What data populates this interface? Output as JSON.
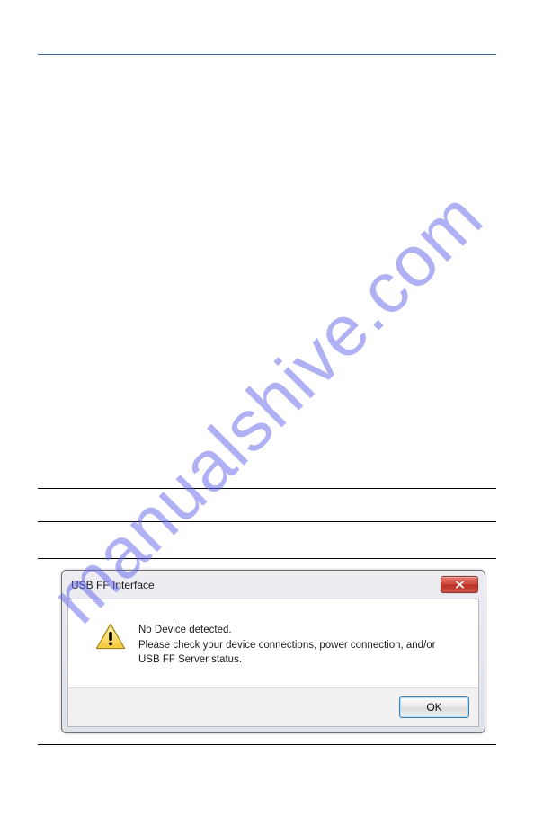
{
  "watermark": "manualshive.com",
  "dialog": {
    "title": "USB FF Interface",
    "message_line1": "No Device detected.",
    "message_line2": " Please check your device connections, power connection, and/or USB FF Server status.",
    "ok_label": "OK"
  }
}
